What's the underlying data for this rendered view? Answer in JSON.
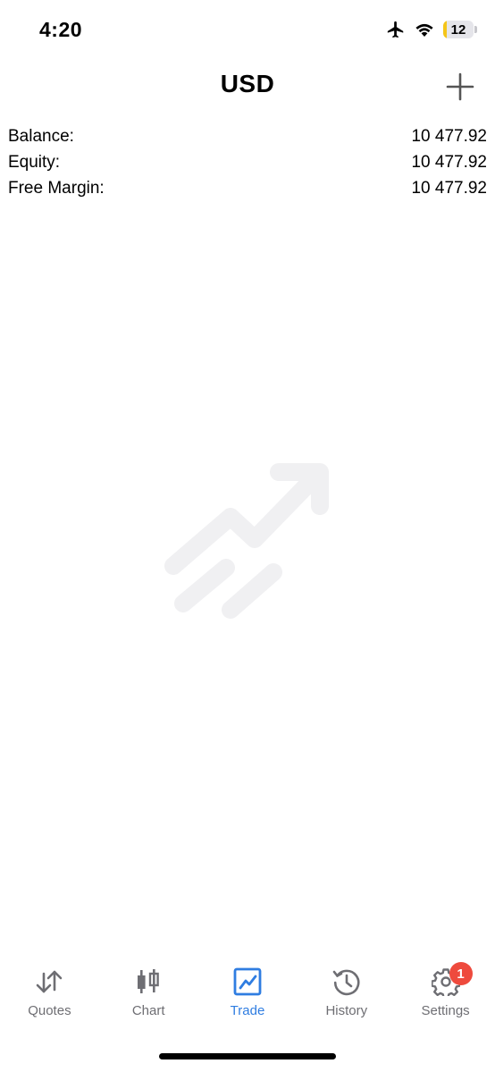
{
  "status_bar": {
    "time": "4:20",
    "battery_level": "12",
    "battery_fraction": 0.12,
    "airplane_mode": true,
    "wifi": true
  },
  "header": {
    "title": "USD",
    "add_icon": "plus-icon"
  },
  "account": {
    "rows": [
      {
        "label": "Balance:",
        "value": "10 477.92"
      },
      {
        "label": "Equity:",
        "value": "10 477.92"
      },
      {
        "label": "Free Margin:",
        "value": "10 477.92"
      }
    ]
  },
  "empty_state": {
    "icon": "trade-chart-icon"
  },
  "tabs": [
    {
      "label": "Quotes",
      "icon": "quotes-arrows-icon",
      "active": false
    },
    {
      "label": "Chart",
      "icon": "candlestick-icon",
      "active": false
    },
    {
      "label": "Trade",
      "icon": "trade-icon",
      "active": true
    },
    {
      "label": "History",
      "icon": "history-icon",
      "active": false
    },
    {
      "label": "Settings",
      "icon": "gear-icon",
      "active": false,
      "badge": "1"
    }
  ],
  "colors": {
    "accent": "#2f7de1",
    "inactive": "#6e6e73",
    "badge": "#ee4a3d",
    "battery_low": "#f5c518",
    "empty_icon": "#f0f0f2"
  }
}
